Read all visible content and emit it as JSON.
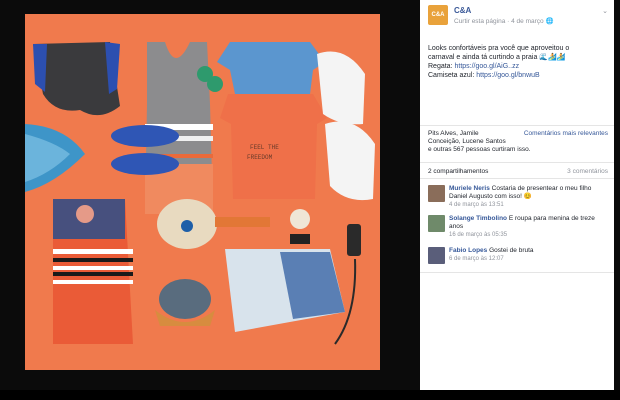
{
  "page": {
    "name": "C&A",
    "logo_text": "C&A",
    "curtir_label": "Curtir esta página",
    "date": "4 de março",
    "separator": "·"
  },
  "post": {
    "line1": "Looks confortáveis pra você que aproveitou o",
    "line2": "carnaval e ainda tá curtindo a praia",
    "regata_label": "Regata:",
    "regata_link": "https://goo.gl/AiG..zz",
    "camiseta_label": "Camiseta azul:",
    "camiseta_link": "https://goo.gl/bnwuB"
  },
  "likes": {
    "text1": "Pits Alves, Jamile",
    "text2": "Conceição, Lucene Santos",
    "text3": "e outras 567 pessoas curtiram isso.",
    "relevance": "Comentários mais relevantes"
  },
  "counts": {
    "shares": "2 compartilhamentos",
    "comments": "3 comentários"
  },
  "comments": [
    {
      "name": "Muriele Neris",
      "text": "Costaria de presentear o meu filho",
      "text2": "Daniel Augusto com isso! 😊",
      "time": "4 de março às 13:51"
    },
    {
      "name": "Solange Timbolino",
      "text": "E roupa para menina de treze",
      "text2": "anos",
      "time": "16 de março às 05:35"
    },
    {
      "name": "Fabio Lopes",
      "text": "Gostei de bruta",
      "text2": "",
      "time": "6 de março às 12:07"
    }
  ],
  "colors": {
    "photo_bg": "#f0764a",
    "link": "#365899",
    "logo": "#e9a23b"
  }
}
